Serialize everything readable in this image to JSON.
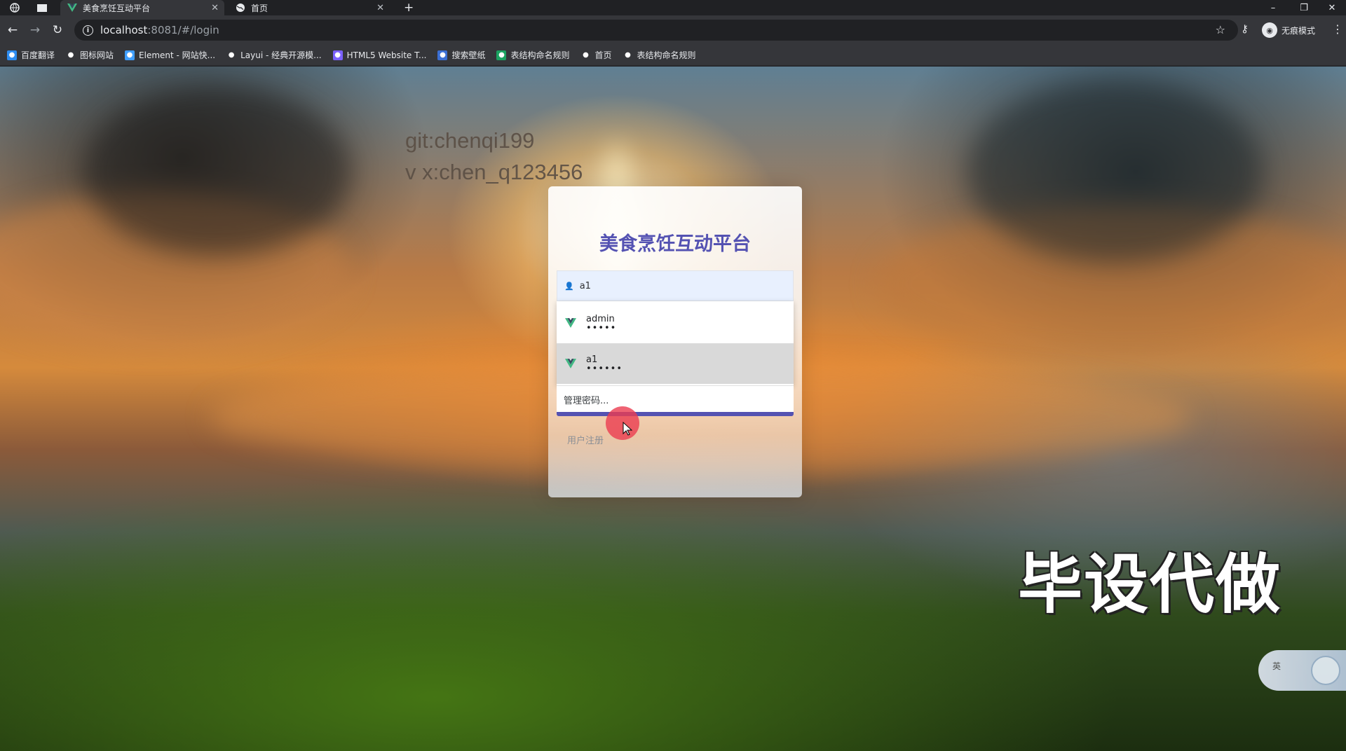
{
  "browser": {
    "tabs": [
      {
        "title": "美食烹饪互动平台",
        "active": true,
        "icon": "vue-logo-icon"
      },
      {
        "title": "首页",
        "active": false,
        "icon": "globe-icon"
      }
    ],
    "new_tab": "+",
    "window_controls": {
      "minimize": "–",
      "restore": "❐",
      "close": "✕"
    },
    "url": {
      "host": "localhost",
      "path": ":8081/#/login"
    },
    "profile_label": "无痕模式",
    "bookmarks": [
      {
        "label": "百度翻译",
        "icon": "translate-icon",
        "color": "#2d8cf0"
      },
      {
        "label": "图标网站",
        "icon": "flag-icon",
        "color": "#35363a"
      },
      {
        "label": "Element - 网站快...",
        "icon": "element-icon",
        "color": "#409eff"
      },
      {
        "label": "Layui - 经典开源模...",
        "icon": "layui-icon",
        "color": "#35363a"
      },
      {
        "label": "HTML5 Website T...",
        "icon": "html5-icon",
        "color": "#7b61ff"
      },
      {
        "label": "搜索壁纸",
        "icon": "wallpaper-icon",
        "color": "#3b6fd4"
      },
      {
        "label": "表结构命名规则",
        "icon": "sheet-icon",
        "color": "#1aa260"
      },
      {
        "label": "首页",
        "icon": "globe-icon",
        "color": "#35363a"
      },
      {
        "label": "表结构命名规则",
        "icon": "globe-icon",
        "color": "#35363a"
      }
    ]
  },
  "watermark": {
    "line1": "git:chenqi199",
    "line2": "v x:chen_q123456",
    "overlay": "毕设代做"
  },
  "login": {
    "title": "美食烹饪互动平台",
    "username_value": "a1",
    "autofill": [
      {
        "username": "admin",
        "password_mask": "•••••"
      },
      {
        "username": "a1",
        "password_mask": "••••••"
      }
    ],
    "manage_passwords": "管理密码...",
    "register_link": "用户注册"
  },
  "ime": {
    "lang": "英"
  },
  "colors": {
    "accent": "#5452b2",
    "input_bg": "#e8f0fe",
    "cursor_highlight": "#eb3c50"
  }
}
